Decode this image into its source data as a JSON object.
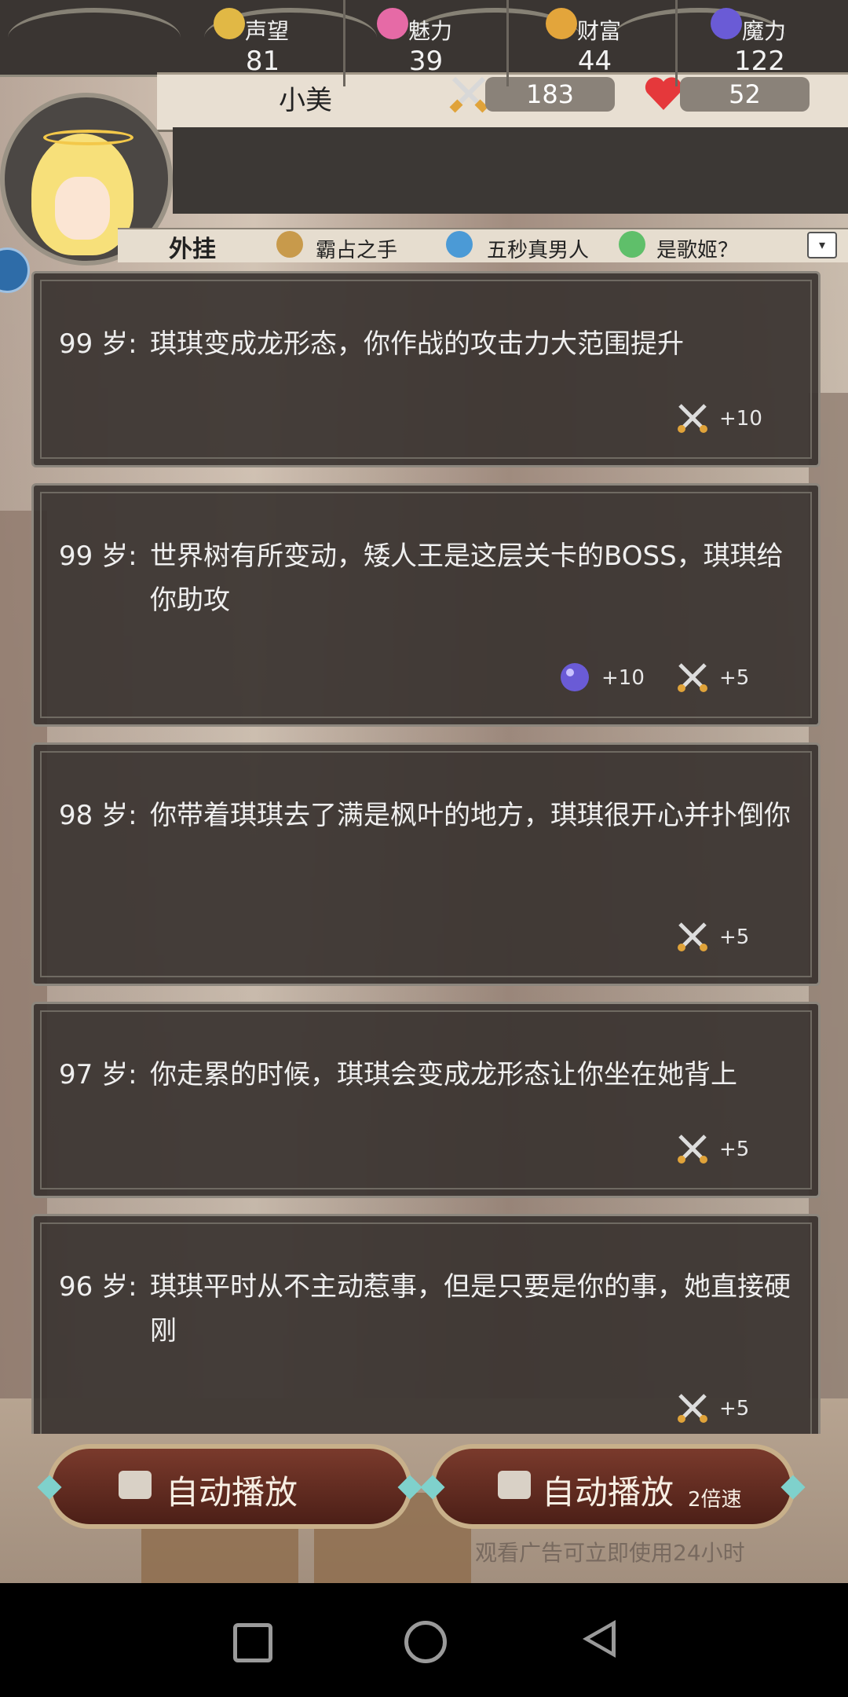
{
  "player": {
    "name": "小美",
    "attack": "183",
    "hp": "52"
  },
  "stats": [
    {
      "icon": "shield-icon",
      "label": "声望",
      "value": "81",
      "color": "#e1b845"
    },
    {
      "icon": "sparkle-icon",
      "label": "魅力",
      "value": "39",
      "color": "#e66aa6"
    },
    {
      "icon": "coins-icon",
      "label": "财富",
      "value": "44",
      "color": "#e3a53b"
    },
    {
      "icon": "magic-orb-icon",
      "label": "魔力",
      "value": "122",
      "color": "#6a5bd6"
    }
  ],
  "cheats": {
    "title": "外挂",
    "items": [
      {
        "icon": "fist-icon",
        "label": "霸占之手"
      },
      {
        "icon": "muscle-man-icon",
        "label": "五秒真男人"
      },
      {
        "icon": "microphone-icon",
        "label": "是歌姬？"
      }
    ],
    "dropdown_icon": "▾"
  },
  "events": [
    {
      "age": "99 岁:",
      "text": "琪琪变成龙形态，你作战的攻击力大范围提升",
      "rewards": [
        {
          "icon": "swords-icon",
          "value": "+10"
        }
      ]
    },
    {
      "age": "99 岁:",
      "text": "世界树有所变动，矮人王是这层关卡的BOSS，琪琪给你助攻",
      "rewards": [
        {
          "icon": "magic-orb-icon",
          "value": "+10"
        },
        {
          "icon": "swords-icon",
          "value": "+5"
        }
      ]
    },
    {
      "age": "98 岁:",
      "text": "你带着琪琪去了满是枫叶的地方，琪琪很开心并扑倒你",
      "rewards": [
        {
          "icon": "swords-icon",
          "value": "+5"
        }
      ]
    },
    {
      "age": "97 岁:",
      "text": "你走累的时候，琪琪会变成龙形态让你坐在她背上",
      "rewards": [
        {
          "icon": "swords-icon",
          "value": "+5"
        }
      ]
    },
    {
      "age": "96 岁:",
      "text": "琪琪平时从不主动惹事，但是只要是你的事，她直接硬刚",
      "rewards": [
        {
          "icon": "swords-icon",
          "value": "+5"
        }
      ]
    }
  ],
  "buttons": {
    "autoplay": "自动播放",
    "autoplay2": "自动播放",
    "speed": "2倍速",
    "ad_note": "观看广告可立即使用24小时"
  }
}
